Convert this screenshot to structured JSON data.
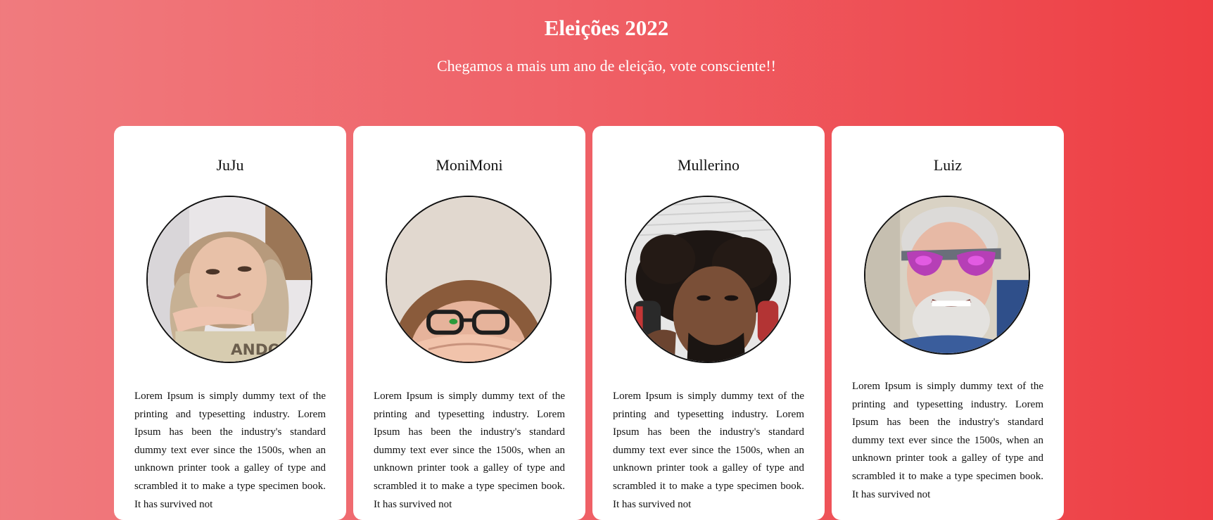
{
  "header": {
    "title": "Eleições 2022",
    "subtitle": "Chegamos a mais um ano de eleição, vote consciente!!"
  },
  "cards": [
    {
      "name": "JuJu",
      "photo": "girl-hand-under-chin-photo",
      "text": "Lorem Ipsum is simply dummy text of the printing and typesetting industry. Lorem Ipsum has been the industry's standard dummy text ever since the 1500s, when an unknown printer took a galley of type and scrambled it to make a type specimen book. It has survived not"
    },
    {
      "name": "MoniMoni",
      "photo": "girl-glasses-covering-mouth-photo",
      "text": "Lorem Ipsum is simply dummy text of the printing and typesetting industry. Lorem Ipsum has been the industry's standard dummy text ever since the 1500s, when an unknown printer took a galley of type and scrambled it to make a type specimen book. It has survived not"
    },
    {
      "name": "Mullerino",
      "photo": "man-curly-hair-headphones-photo",
      "text": "Lorem Ipsum is simply dummy text of the printing and typesetting industry. Lorem Ipsum has been the industry's standard dummy text ever since the 1500s, when an unknown printer took a galley of type and scrambled it to make a type specimen book. It has survived not"
    },
    {
      "name": "Luiz",
      "photo": "older-man-sunglasses-photo",
      "text": "Lorem Ipsum is simply dummy text of the printing and typesetting industry. Lorem Ipsum has been the industry's standard dummy text ever since the 1500s, when an unknown printer took a galley of type and scrambled it to make a type specimen book. It has survived not"
    }
  ],
  "colors": {
    "background_start": "#f07b7e",
    "background_end": "#ee3e43",
    "card": "#ffffff",
    "text": "#111111"
  }
}
